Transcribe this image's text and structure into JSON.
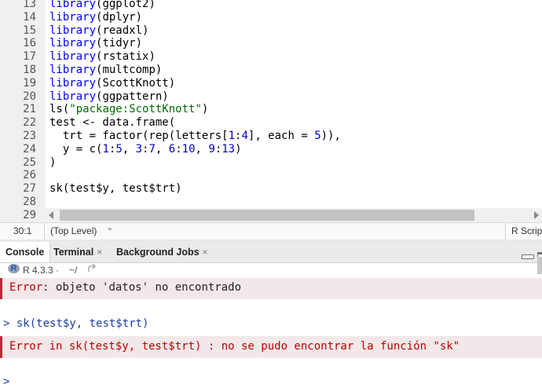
{
  "editor": {
    "lines": [
      {
        "num": "13",
        "tokens": [
          {
            "t": "kw",
            "v": "library"
          },
          {
            "t": "plain",
            "v": "(ggplot2)"
          }
        ]
      },
      {
        "num": "14",
        "tokens": [
          {
            "t": "kw",
            "v": "library"
          },
          {
            "t": "plain",
            "v": "(dplyr)"
          }
        ]
      },
      {
        "num": "15",
        "tokens": [
          {
            "t": "kw",
            "v": "library"
          },
          {
            "t": "plain",
            "v": "(readxl)"
          }
        ]
      },
      {
        "num": "16",
        "tokens": [
          {
            "t": "kw",
            "v": "library"
          },
          {
            "t": "plain",
            "v": "(tidyr)"
          }
        ]
      },
      {
        "num": "17",
        "tokens": [
          {
            "t": "kw",
            "v": "library"
          },
          {
            "t": "plain",
            "v": "(rstatix)"
          }
        ]
      },
      {
        "num": "18",
        "tokens": [
          {
            "t": "kw",
            "v": "library"
          },
          {
            "t": "plain",
            "v": "(multcomp)"
          }
        ]
      },
      {
        "num": "19",
        "tokens": [
          {
            "t": "kw",
            "v": "library"
          },
          {
            "t": "plain",
            "v": "(ScottKnott)"
          }
        ]
      },
      {
        "num": "20",
        "tokens": [
          {
            "t": "kw",
            "v": "library"
          },
          {
            "t": "plain",
            "v": "(ggpattern)"
          }
        ]
      },
      {
        "num": "21",
        "tokens": [
          {
            "t": "plain",
            "v": "ls("
          },
          {
            "t": "str",
            "v": "\"package:ScottKnott\""
          },
          {
            "t": "plain",
            "v": ")"
          }
        ]
      },
      {
        "num": "22",
        "tokens": [
          {
            "t": "plain",
            "v": "test <- data.frame("
          }
        ]
      },
      {
        "num": "23",
        "tokens": [
          {
            "t": "plain",
            "v": "  trt = factor(rep(letters["
          },
          {
            "t": "num",
            "v": "1"
          },
          {
            "t": "plain",
            "v": ":"
          },
          {
            "t": "num",
            "v": "4"
          },
          {
            "t": "plain",
            "v": "], each = "
          },
          {
            "t": "num",
            "v": "5"
          },
          {
            "t": "plain",
            "v": ")),"
          }
        ]
      },
      {
        "num": "24",
        "tokens": [
          {
            "t": "plain",
            "v": "  y = c("
          },
          {
            "t": "num",
            "v": "1"
          },
          {
            "t": "plain",
            "v": ":"
          },
          {
            "t": "num",
            "v": "5"
          },
          {
            "t": "plain",
            "v": ", "
          },
          {
            "t": "num",
            "v": "3"
          },
          {
            "t": "plain",
            "v": ":"
          },
          {
            "t": "num",
            "v": "7"
          },
          {
            "t": "plain",
            "v": ", "
          },
          {
            "t": "num",
            "v": "6"
          },
          {
            "t": "plain",
            "v": ":"
          },
          {
            "t": "num",
            "v": "10"
          },
          {
            "t": "plain",
            "v": ", "
          },
          {
            "t": "num",
            "v": "9"
          },
          {
            "t": "plain",
            "v": ":"
          },
          {
            "t": "num",
            "v": "13"
          },
          {
            "t": "plain",
            "v": ")"
          }
        ]
      },
      {
        "num": "25",
        "tokens": [
          {
            "t": "plain",
            "v": ")"
          }
        ]
      },
      {
        "num": "26",
        "tokens": []
      },
      {
        "num": "27",
        "tokens": [
          {
            "t": "plain",
            "v": "sk(test$y, test$trt)"
          }
        ]
      },
      {
        "num": "28",
        "tokens": []
      },
      {
        "num": "29",
        "tokens": []
      }
    ]
  },
  "status_bar": {
    "cursor_position": "30:1",
    "scope": "(Top Level)",
    "scope_caret": "÷",
    "file_type": "R Script"
  },
  "tabs": [
    {
      "label": "Console",
      "closable": false
    },
    {
      "label": "Terminal",
      "closable": true
    },
    {
      "label": "Background Jobs",
      "closable": true
    }
  ],
  "tab_close_glyph": "×",
  "console": {
    "r_logo": "R",
    "r_version": "R 4.3.3 ·",
    "working_dir": "~/",
    "entries": [
      {
        "type": "error",
        "prefix": "Error",
        "message": ": objeto 'datos' no encontrado"
      },
      {
        "type": "command",
        "prompt": ">",
        "text": " sk(test$y, test$trt)"
      },
      {
        "type": "error",
        "prefix": "Error in sk(test$y, test$trt) : no se pudo encontrar la función \"sk\"",
        "message": ""
      },
      {
        "type": "prompt",
        "prompt": ">",
        "text": ""
      }
    ]
  },
  "colors": {
    "keyword": "#0000ff",
    "string": "#036a07",
    "number": "#0000cd",
    "error_text": "#c00000",
    "error_bg": "#f2e8e9",
    "prompt": "#1a3fa6"
  }
}
